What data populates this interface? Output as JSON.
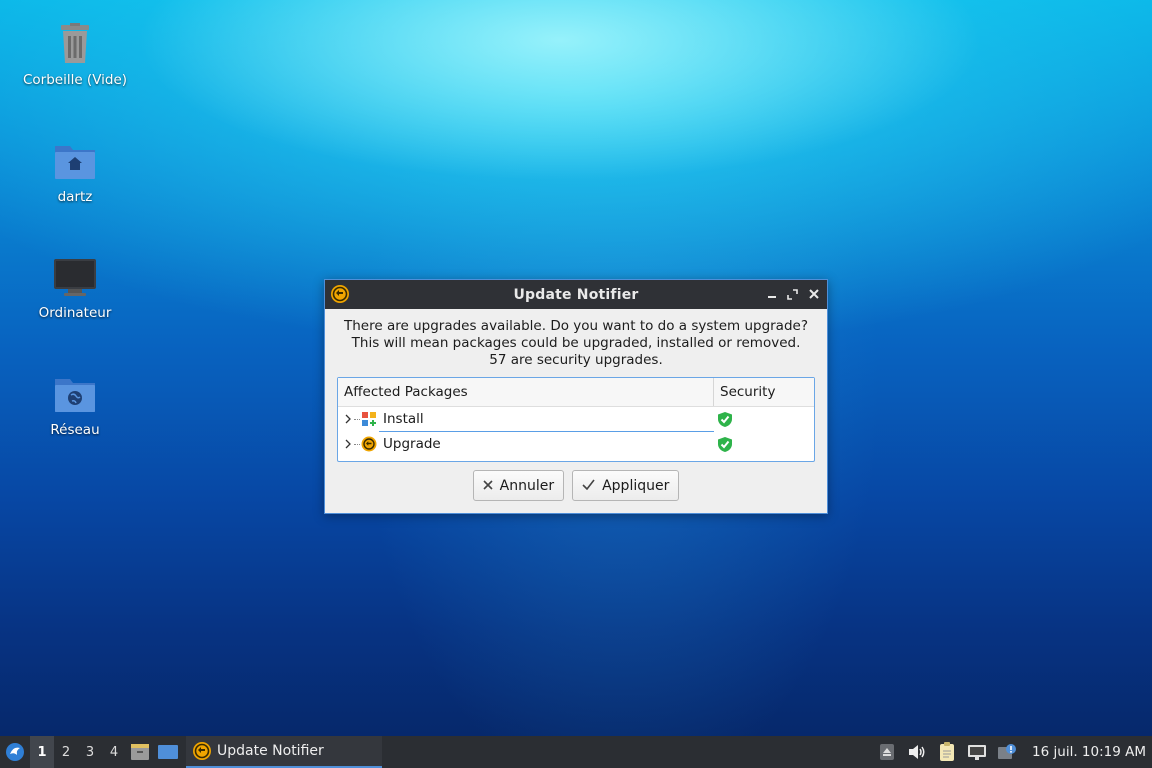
{
  "desktop": {
    "icons": [
      {
        "label": "Corbeille (Vide)",
        "icon": "trash-icon"
      },
      {
        "label": "dartz",
        "icon": "home-folder-icon"
      },
      {
        "label": "Ordinateur",
        "icon": "computer-icon"
      },
      {
        "label": "Réseau",
        "icon": "network-folder-icon"
      }
    ]
  },
  "dialog": {
    "title": "Update Notifier",
    "message_line1": "There are upgrades available. Do you want to do a system upgrade?",
    "message_line2": "This will mean packages could be upgraded, installed or removed.",
    "message_line3": "57 are security upgrades.",
    "table": {
      "col_packages": "Affected Packages",
      "col_security": "Security",
      "rows": [
        {
          "label": "Install",
          "icon": "install-package-icon",
          "security_icon": "shield-check-icon"
        },
        {
          "label": "Upgrade",
          "icon": "upgrade-icon",
          "security_icon": "shield-check-icon"
        }
      ]
    },
    "buttons": {
      "cancel": "Annuler",
      "apply": "Appliquer"
    }
  },
  "taskbar": {
    "workspaces": [
      "1",
      "2",
      "3",
      "4"
    ],
    "active_workspace": "1",
    "task_label": "Update Notifier",
    "clock": "16 juil. 10:19 AM"
  },
  "colors": {
    "accent": "#4f8fd9",
    "taskbar_bg": "#2b2e33",
    "titlebar_bg": "#2f3136",
    "shield_green": "#2eb34a"
  }
}
